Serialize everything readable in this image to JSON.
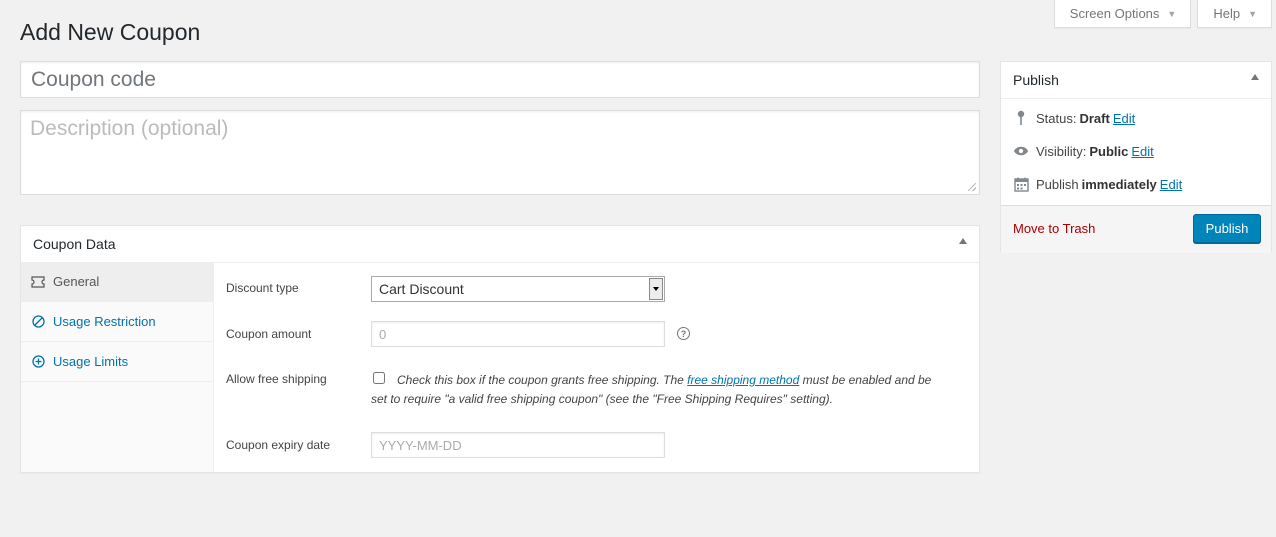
{
  "screen_options": {
    "screen_options_label": "Screen Options",
    "help_label": "Help"
  },
  "page": {
    "title": "Add New Coupon",
    "coupon_code_placeholder": "Coupon code",
    "description_placeholder": "Description (optional)"
  },
  "coupon_data": {
    "title": "Coupon Data",
    "tabs": [
      {
        "label": "General",
        "icon": "ticket-icon",
        "active": true
      },
      {
        "label": "Usage Restriction",
        "icon": "no-entry-icon",
        "active": false
      },
      {
        "label": "Usage Limits",
        "icon": "plus-circle-icon",
        "active": false
      }
    ],
    "general": {
      "discount_type_label": "Discount type",
      "discount_type_value": "Cart Discount",
      "coupon_amount_label": "Coupon amount",
      "coupon_amount_placeholder": "0",
      "free_shipping_label": "Allow free shipping",
      "free_shipping_desc_before": "Check this box if the coupon grants free shipping. The ",
      "free_shipping_link": "free shipping method",
      "free_shipping_desc_after": " must be enabled and be",
      "free_shipping_desc_line2": "set to require \"a valid free shipping coupon\" (see the \"Free Shipping Requires\" setting).",
      "expiry_label": "Coupon expiry date",
      "expiry_placeholder": "YYYY-MM-DD"
    }
  },
  "publish": {
    "title": "Publish",
    "status_label": "Status:",
    "status_value": "Draft",
    "visibility_label": "Visibility:",
    "visibility_value": "Public",
    "publish_label": "Publish",
    "publish_value": "immediately",
    "edit_label": "Edit",
    "trash_label": "Move to Trash",
    "publish_button": "Publish"
  },
  "colors": {
    "accent": "#0085ba",
    "link": "#0073aa",
    "trash": "#a00"
  }
}
